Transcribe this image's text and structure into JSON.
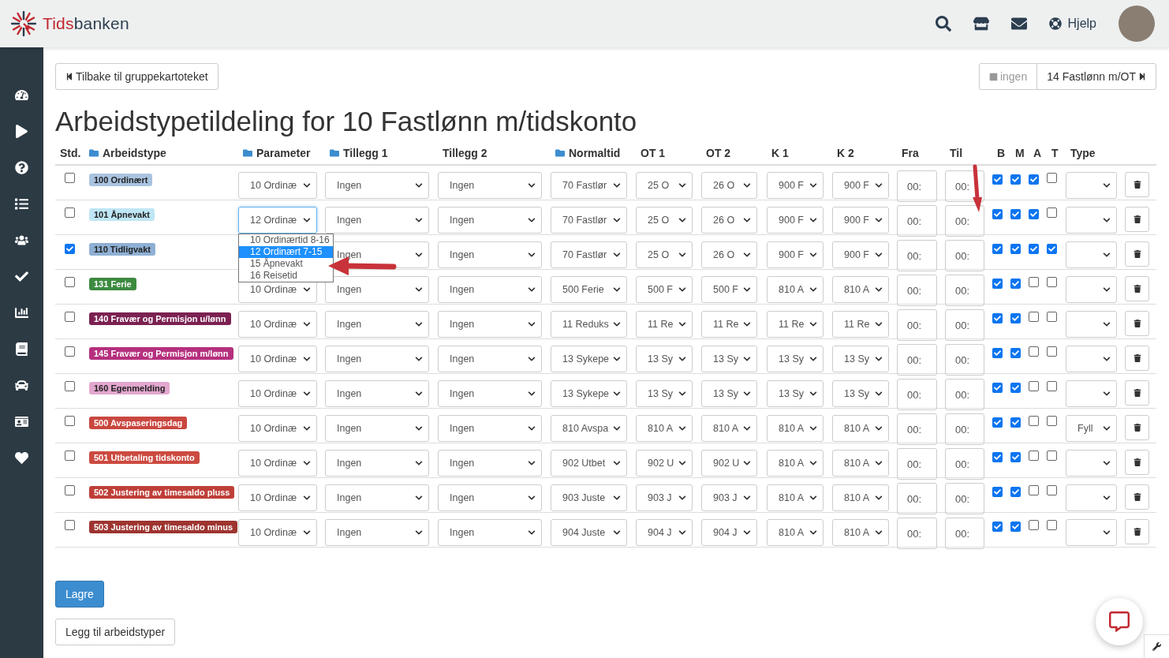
{
  "brand": {
    "highlight": "Tids",
    "text": "banken"
  },
  "topbar": {
    "help": "Hjelp"
  },
  "back_button": "Tilbake til gruppekartoteket",
  "pager": [
    {
      "label": "ingen",
      "disabled": true
    },
    {
      "label": "14 Fastlønn m/OT",
      "disabled": false
    }
  ],
  "title": "Arbeidstypetildeling for 10 Fastlønn m/tidskonto",
  "columns": [
    {
      "label": "Std.",
      "folder": false
    },
    {
      "label": "Arbeidstype",
      "folder": true
    },
    {
      "label": "Parameter",
      "folder": true
    },
    {
      "label": "Tillegg 1",
      "folder": true
    },
    {
      "label": "Tillegg 2",
      "folder": false
    },
    {
      "label": "Normaltid",
      "folder": true
    },
    {
      "label": "OT 1",
      "folder": false
    },
    {
      "label": "OT 2",
      "folder": false
    },
    {
      "label": "K 1",
      "folder": false
    },
    {
      "label": "K 2",
      "folder": false
    },
    {
      "label": "Fra",
      "folder": false
    },
    {
      "label": "Til",
      "folder": false
    },
    {
      "label": "B",
      "folder": false
    },
    {
      "label": "M",
      "folder": false
    },
    {
      "label": "A",
      "folder": false
    },
    {
      "label": "T",
      "folder": false
    },
    {
      "label": "Type",
      "folder": false
    }
  ],
  "rows": [
    {
      "std": false,
      "label": "100 Ordinært",
      "color": "#a9c4e0",
      "parameter": "10 Ordinæ",
      "selects": [
        "Ingen",
        "Ingen",
        "70 Fastlør",
        "25 O",
        "26 O",
        "900 F",
        "900 F"
      ],
      "times": [
        "00:",
        "00:"
      ],
      "flags": [
        true,
        true,
        true,
        false
      ]
    },
    {
      "std": false,
      "label": "101 Åpnevakt",
      "color": "#bfe6f5",
      "parameter": "12 Ordinæ",
      "selects": [
        "Ingen",
        "Ingen",
        "70 Fastlør",
        "25 O",
        "26 O",
        "900 F",
        "900 F"
      ],
      "times": [
        "00:",
        "00:"
      ],
      "flags": [
        true,
        true,
        true,
        false
      ],
      "dropdown": [
        {
          "label": "10 Ordinærtid 8-16",
          "selected": false
        },
        {
          "label": "12 Ordinært 7-15",
          "selected": true
        },
        {
          "label": "15 Åpnevakt",
          "selected": false
        },
        {
          "label": "16 Reisetid",
          "selected": false
        }
      ]
    },
    {
      "std": true,
      "label": "110 Tidligvakt",
      "color": "#8fb0d4",
      "selects": [
        "Ingen",
        "Ingen",
        "70 Fastlør",
        "25 O",
        "26 O",
        "900 F",
        "900 F"
      ],
      "times": [
        "00:",
        "00:"
      ],
      "flags": [
        true,
        true,
        true,
        true
      ]
    },
    {
      "std": false,
      "label": "131 Ferie",
      "color": "#3d8a40",
      "parameter": "10 Ordinæ",
      "selects": [
        "Ingen",
        "Ingen",
        "500 Ferie",
        "500 F",
        "500 F",
        "810 A",
        "810 A"
      ],
      "times": [
        "00:",
        "00:"
      ],
      "flags": [
        true,
        true,
        false,
        false
      ]
    },
    {
      "std": false,
      "label": "140 Fravær og Permisjon u/lønn",
      "color": "#7b2151",
      "parameter": "10 Ordinæ",
      "selects": [
        "Ingen",
        "Ingen",
        "11 Reduks",
        "11 Re",
        "11 Re",
        "11 Re",
        "11 Re"
      ],
      "times": [
        "00:",
        "00:"
      ],
      "flags": [
        true,
        true,
        false,
        false
      ]
    },
    {
      "std": false,
      "label": "145 Fravær og Permisjon m/lønn",
      "color": "#b5307e",
      "parameter": "10 Ordinæ",
      "selects": [
        "Ingen",
        "Ingen",
        "13 Sykepe",
        "13 Sy",
        "13 Sy",
        "13 Sy",
        "13 Sy"
      ],
      "times": [
        "00:",
        "00:"
      ],
      "flags": [
        true,
        true,
        false,
        false
      ]
    },
    {
      "std": false,
      "label": "160 Egenmelding",
      "color": "#e2a7cf",
      "parameter": "10 Ordinæ",
      "selects": [
        "Ingen",
        "Ingen",
        "13 Sykepe",
        "13 Sy",
        "13 Sy",
        "13 Sy",
        "13 Sy"
      ],
      "times": [
        "00:",
        "00:"
      ],
      "flags": [
        true,
        true,
        false,
        false
      ]
    },
    {
      "std": false,
      "label": "500 Avspaseringsdag",
      "color": "#c9473f",
      "parameter": "10 Ordinæ",
      "selects": [
        "Ingen",
        "Ingen",
        "810 Avspa",
        "810 A",
        "810 A",
        "810 A",
        "810 A"
      ],
      "times": [
        "00:",
        "00:"
      ],
      "flags": [
        true,
        true,
        false,
        false
      ],
      "type": "Fyll"
    },
    {
      "std": false,
      "label": "501 Utbetaling tidskonto",
      "color": "#cc4a40",
      "parameter": "10 Ordinæ",
      "selects": [
        "Ingen",
        "Ingen",
        "902 Utbet",
        "902 U",
        "902 U",
        "810 A",
        "810 A"
      ],
      "times": [
        "00:",
        "00:"
      ],
      "flags": [
        true,
        true,
        false,
        false
      ]
    },
    {
      "std": false,
      "label": "502 Justering av timesaldo pluss",
      "color": "#bf3f39",
      "parameter": "10 Ordinæ",
      "selects": [
        "Ingen",
        "Ingen",
        "903 Juste",
        "903 J",
        "903 J",
        "810 A",
        "810 A"
      ],
      "times": [
        "00:",
        "00:"
      ],
      "flags": [
        true,
        true,
        false,
        false
      ]
    },
    {
      "std": false,
      "label": "503 Justering av timesaldo minus",
      "color": "#9e3430",
      "parameter": "10 Ordinæ",
      "selects": [
        "Ingen",
        "Ingen",
        "904 Juste",
        "904 J",
        "904 J",
        "810 A",
        "810 A"
      ],
      "times": [
        "00:",
        "00:"
      ],
      "flags": [
        true,
        true,
        false,
        false
      ]
    }
  ],
  "save_button": "Lagre",
  "add_button": "Legg til arbeidstyper"
}
